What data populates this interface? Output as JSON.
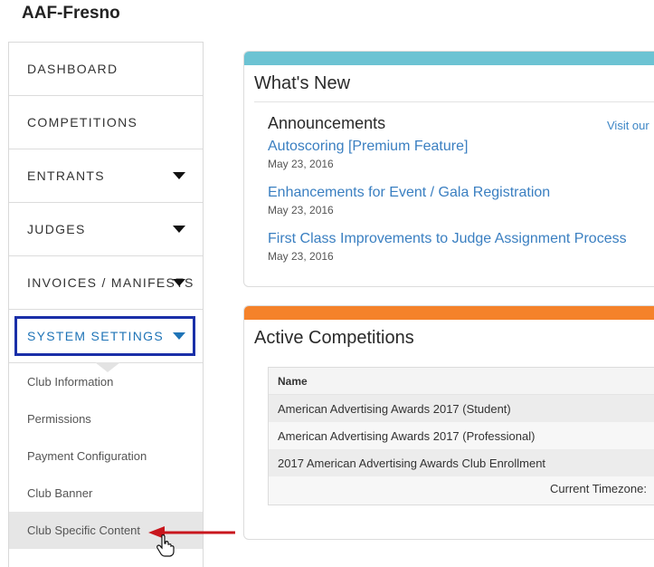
{
  "header": {
    "org_name": "AAF-Fresno"
  },
  "sidebar": {
    "items": [
      {
        "label": "DASHBOARD",
        "has_caret": false
      },
      {
        "label": "COMPETITIONS",
        "has_caret": false
      },
      {
        "label": "ENTRANTS",
        "has_caret": true
      },
      {
        "label": "JUDGES",
        "has_caret": true
      },
      {
        "label": "INVOICES / MANIFESTS",
        "has_caret": true
      },
      {
        "label": "SYSTEM SETTINGS",
        "has_caret": true,
        "active": true
      }
    ],
    "submenu": [
      "Club Information",
      "Permissions",
      "Payment Configuration",
      "Club Banner",
      "Club Specific Content"
    ]
  },
  "whats_new": {
    "title": "What's New",
    "bar_color": "#6cc3d3",
    "announcements_heading": "Announcements",
    "visit_link": "Visit our",
    "items": [
      {
        "title": "Autoscoring [Premium Feature]",
        "date": "May 23, 2016"
      },
      {
        "title": "Enhancements for Event / Gala Registration",
        "date": "May 23, 2016"
      },
      {
        "title": "First Class Improvements to Judge Assignment Process",
        "date": "May 23, 2016"
      }
    ]
  },
  "active_competitions": {
    "title": "Active Competitions",
    "bar_color": "#f5822a",
    "column_header": "Name",
    "rows": [
      "American Advertising Awards 2017 (Student)",
      "American Advertising Awards 2017 (Professional)",
      "2017 American Advertising Awards Club Enrollment"
    ],
    "timezone_label": "Current Timezone:"
  },
  "colors": {
    "accent_blue": "#1f74b7",
    "highlight_box": "#1a2fa8",
    "annotation_arrow": "#c8161d"
  }
}
